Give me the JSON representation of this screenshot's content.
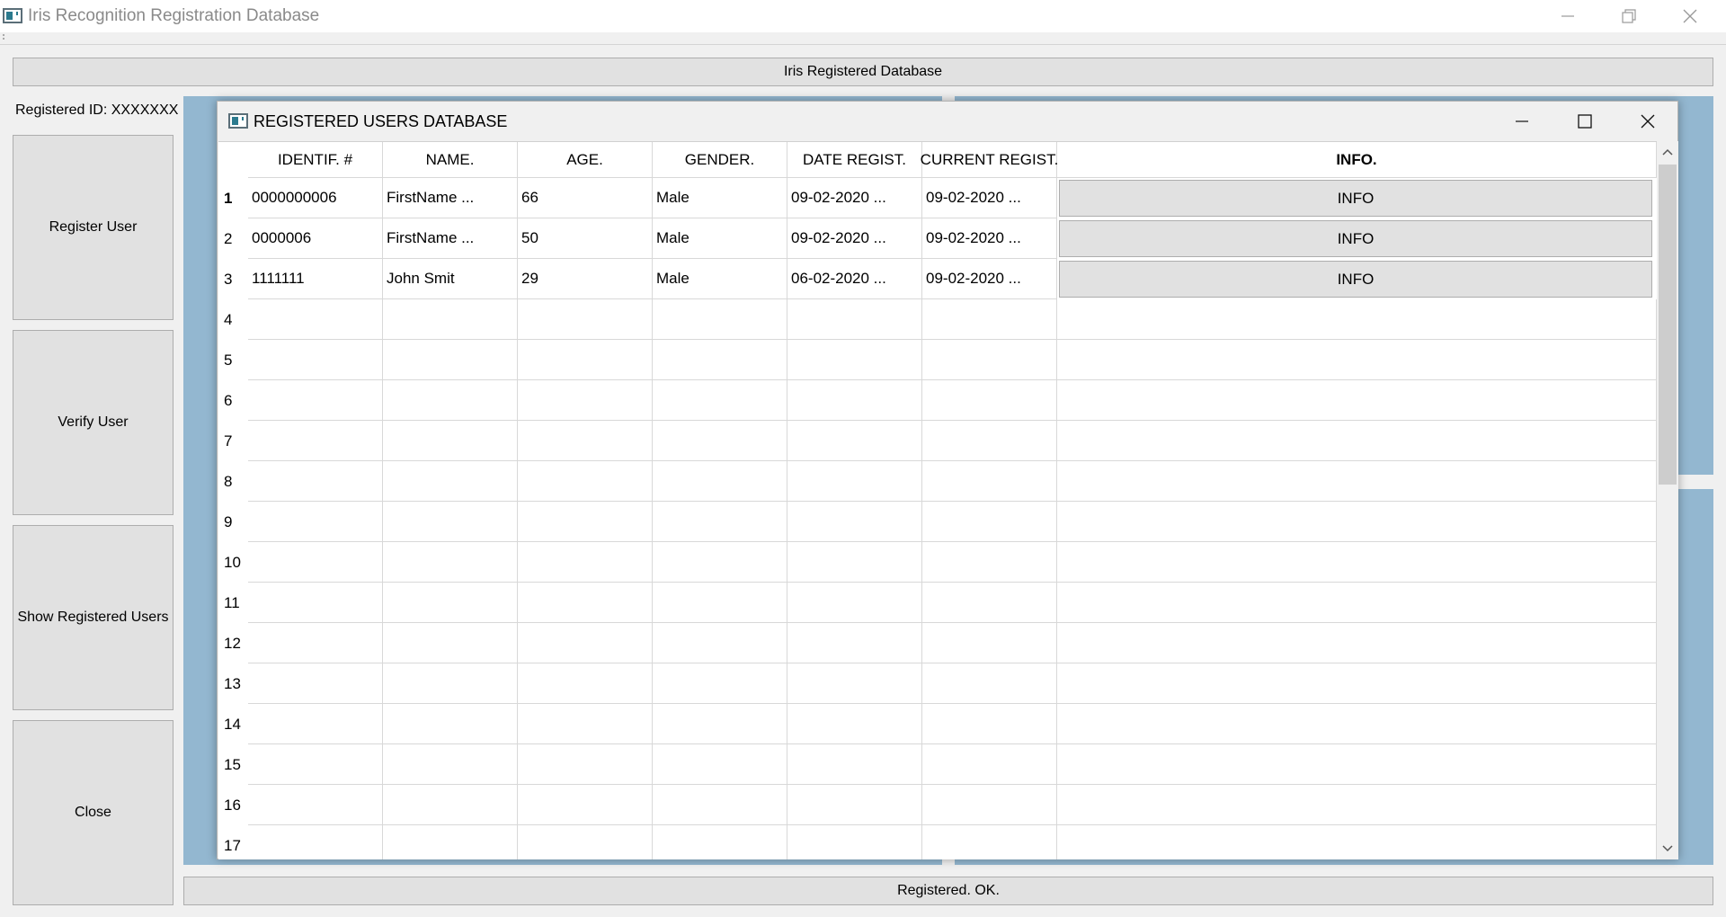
{
  "window": {
    "title": "Iris Recognition Registration Database"
  },
  "header": {
    "label": "Iris Registered Database"
  },
  "sidebar": {
    "registered_id": "Registered ID: XXXXXXX",
    "buttons": [
      {
        "label": "Register User"
      },
      {
        "label": "Verify User"
      },
      {
        "label": "Show Registered Users"
      },
      {
        "label": "Close"
      }
    ]
  },
  "status": {
    "text": "Registered. OK."
  },
  "child_window": {
    "title": "REGISTERED USERS DATABASE",
    "columns": [
      "IDENTIF. #",
      "NAME.",
      "AGE.",
      "GENDER.",
      "DATE REGIST.",
      "CURRENT REGIST.",
      "INFO."
    ],
    "rows": [
      {
        "num": "1",
        "id": "0000000006",
        "name": "FirstName ...",
        "age": "66",
        "gender": "Male",
        "date": "09-02-2020 ...",
        "current": "09-02-2020 ...",
        "info": "INFO"
      },
      {
        "num": "2",
        "id": "0000006",
        "name": "FirstName ...",
        "age": "50",
        "gender": "Male",
        "date": "09-02-2020 ...",
        "current": "09-02-2020 ...",
        "info": "INFO"
      },
      {
        "num": "3",
        "id": "1111111",
        "name": "John Smit",
        "age": "29",
        "gender": "Male",
        "date": "06-02-2020 ...",
        "current": "09-02-2020 ...",
        "info": "INFO"
      }
    ],
    "empty_row_numbers": [
      "4",
      "5",
      "6",
      "7",
      "8",
      "9",
      "10",
      "11",
      "12",
      "13",
      "14",
      "15",
      "16",
      "17"
    ]
  },
  "icons": {
    "app": "app-icon",
    "minimize": "minimize-icon",
    "restore": "restore-icon",
    "maximize": "maximize-icon",
    "close": "close-icon",
    "scroll_up": "chevron-up-icon",
    "scroll_down": "chevron-down-icon"
  },
  "colors": {
    "mdi_background": "#93b7d0",
    "button_face": "#e1e1e1",
    "window_background": "#f0f0f0"
  }
}
